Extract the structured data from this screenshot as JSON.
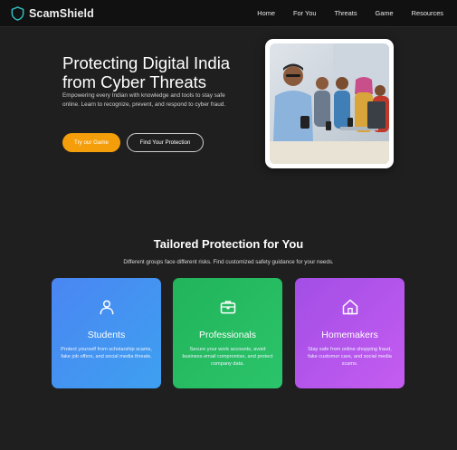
{
  "brand": {
    "name": "ScamShield",
    "icon": "shield-icon"
  },
  "nav": {
    "links": [
      "Home",
      "For You",
      "Threats",
      "Game",
      "Resources"
    ]
  },
  "hero": {
    "title": "Protecting Digital India from Cyber Threats",
    "subtitle": "Empowering every Indian with knowledge and tools to stay safe online. Learn to recognize, prevent, and respond to cyber fraud.",
    "primary_button": "Try our Game",
    "secondary_button": "Find Your Protection"
  },
  "section": {
    "title": "Tailored Protection for You",
    "subtitle": "Different groups face different risks. Find customized safety guidance for your needs."
  },
  "cards": [
    {
      "title": "Students",
      "description": "Protect yourself from scholarship scams, fake job offers, and social media threats.",
      "icon": "user-icon",
      "color": "#4a86f2"
    },
    {
      "title": "Professionals",
      "description": "Secure your work accounts, avoid business email compromise, and protect company data.",
      "icon": "briefcase-icon",
      "color": "#22b45a"
    },
    {
      "title": "Homemakers",
      "description": "Stay safe from online shopping fraud, fake customer care, and social media scams.",
      "icon": "home-icon",
      "color": "#a24ee6"
    }
  ],
  "colors": {
    "accent": "#f59e0b",
    "background": "#1f1f1f",
    "nav": "#111111"
  }
}
